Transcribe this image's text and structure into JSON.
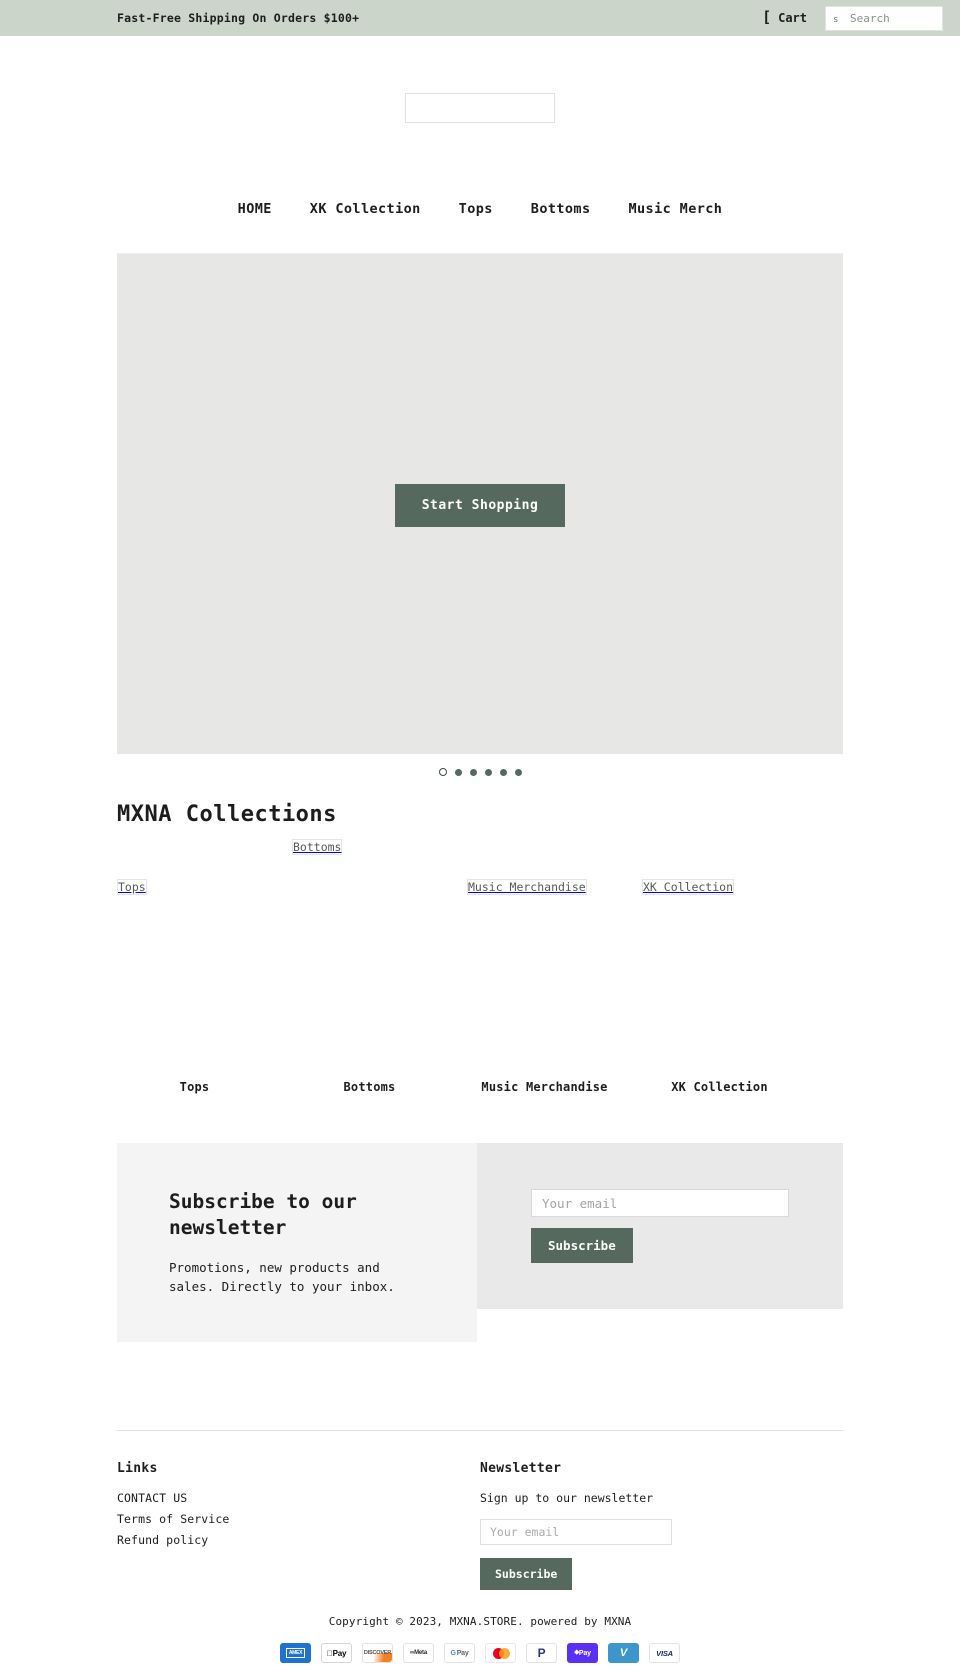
{
  "announcement": {
    "text": "Fast-Free Shipping On Orders $100+",
    "cart_label": "Cart",
    "cart_icon": "shopping-bag-icon",
    "search_placeholder": "Search",
    "search_value": "",
    "search_submit_label": "s"
  },
  "logo": {
    "alt": ""
  },
  "nav": {
    "items": [
      {
        "label": "HOME"
      },
      {
        "label": "XK Collection"
      },
      {
        "label": "Tops"
      },
      {
        "label": "Bottoms"
      },
      {
        "label": "Music Merch"
      }
    ]
  },
  "hero": {
    "button_label": "Start Shopping",
    "slides": 6,
    "active_slide": 1
  },
  "collections": {
    "title": "MXNA Collections",
    "items": [
      {
        "alt": "Tops",
        "caption": "Tops"
      },
      {
        "alt": "Bottoms",
        "caption": "Bottoms"
      },
      {
        "alt": "Music Merchandise",
        "caption": "Music Merchandise"
      },
      {
        "alt": "XK Collection",
        "caption": "XK Collection"
      }
    ]
  },
  "promo": {
    "heading": "Subscribe to our newsletter",
    "subtext": "Promotions, new products and sales. Directly to your inbox.",
    "email_placeholder": "Your email",
    "email_value": "",
    "button_label": "Subscribe"
  },
  "footer": {
    "links_heading": "Links",
    "links": [
      {
        "label": "CONTACT US"
      },
      {
        "label": "Terms of Service"
      },
      {
        "label": "Refund policy"
      }
    ],
    "newsletter_heading": "Newsletter",
    "newsletter_text": "Sign up to our newsletter",
    "email_placeholder": "Your email",
    "email_value": "",
    "button_label": "Subscribe",
    "copyright": "Copyright © 2023, MXNA.STORE. powered by MXNA",
    "payments": [
      {
        "name": "american-express",
        "label": "AMEX"
      },
      {
        "name": "apple-pay",
        "label": "Pay"
      },
      {
        "name": "discover",
        "label": "DISCOVER"
      },
      {
        "name": "meta-pay",
        "label": "Meta"
      },
      {
        "name": "google-pay",
        "label": "Pay"
      },
      {
        "name": "mastercard",
        "label": ""
      },
      {
        "name": "paypal",
        "label": "P"
      },
      {
        "name": "shop-pay",
        "label": "Pay"
      },
      {
        "name": "venmo",
        "label": "V"
      },
      {
        "name": "visa",
        "label": "VISA"
      }
    ]
  },
  "colors": {
    "accent": "#55695f",
    "announcement_bg": "#ccd5c9",
    "hero_bg": "#e7e7e6",
    "promo_left_bg": "#f4f4f4",
    "promo_right_bg": "#e9e9e9"
  }
}
